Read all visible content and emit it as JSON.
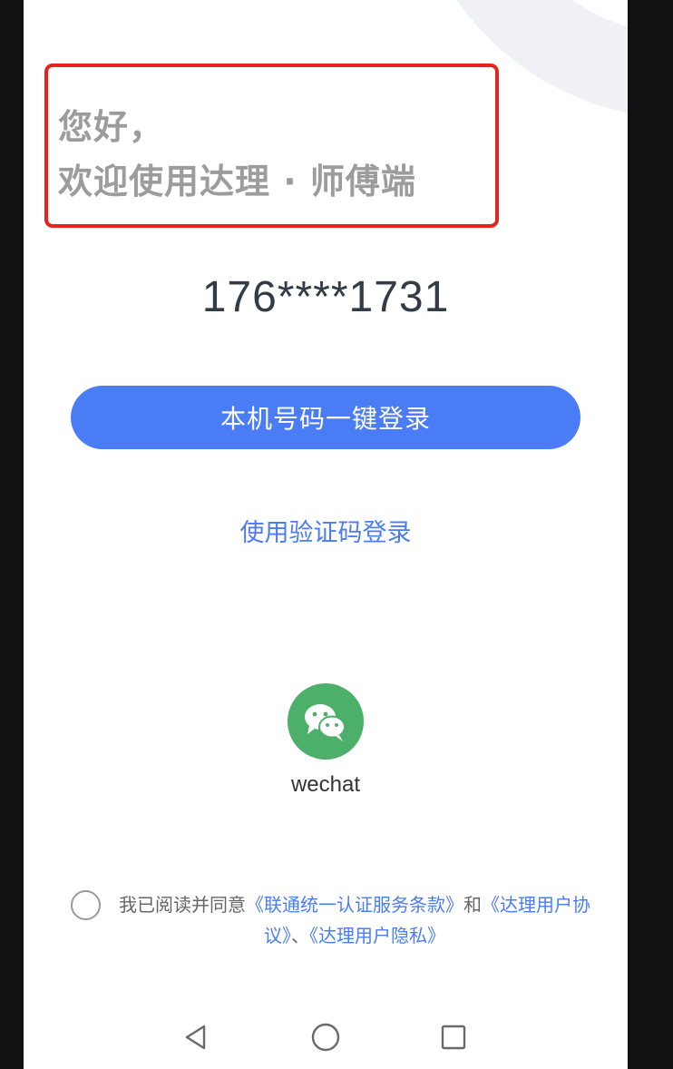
{
  "greeting": {
    "line1": "您好，",
    "line2": "欢迎使用达理 · 师傅端"
  },
  "phone": {
    "masked_number": "176****1731"
  },
  "actions": {
    "one_click_login_label": "本机号码一键登录",
    "sms_login_label": "使用验证码登录"
  },
  "third_party": {
    "wechat_label": "wechat",
    "icon": "wechat-icon"
  },
  "agreement": {
    "checked": false,
    "prefix": "我已阅读并同意",
    "link1": "《联通统一认证服务条款》",
    "conj": "和",
    "link2": "《达理用户协议》",
    "sep": "、",
    "link3": "《达理用户隐私》"
  },
  "nav": {
    "back_icon": "back-triangle-icon",
    "home_icon": "home-circle-icon",
    "recents_icon": "recents-square-icon"
  },
  "colors": {
    "accent": "#4a7cf6",
    "highlight_border": "#e8231f",
    "wechat_green": "#4caf6a",
    "greeting_text": "#9c9c9c"
  }
}
